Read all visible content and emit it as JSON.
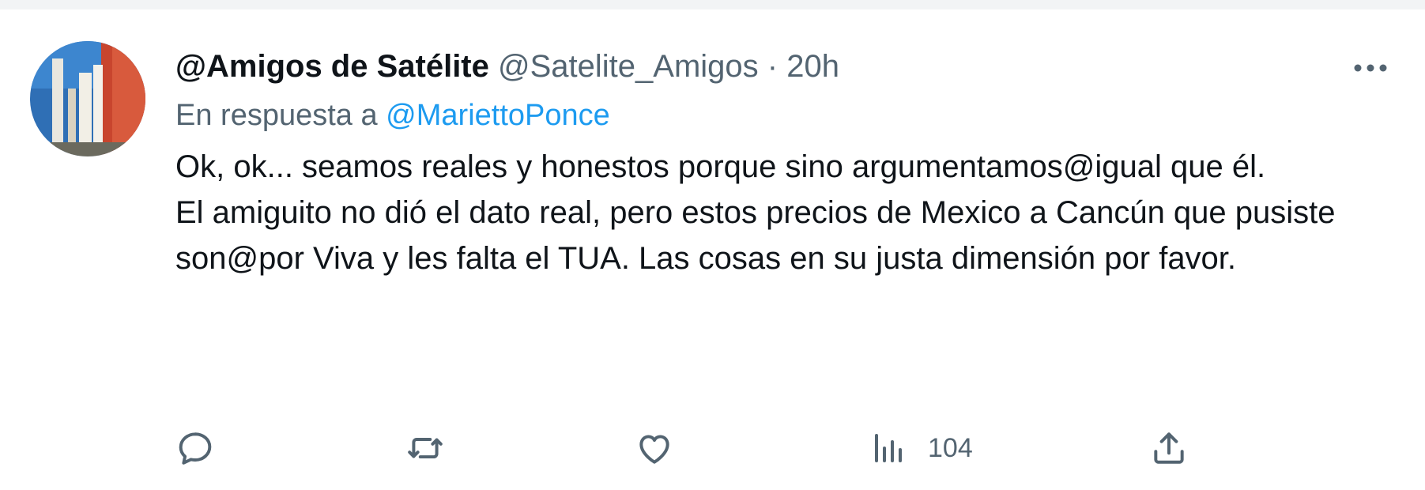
{
  "tweet": {
    "display_name": "@Amigos de Satélite",
    "handle": "@Satelite_Amigos",
    "separator": "·",
    "time": "20h",
    "reply_prefix": "En respuesta a",
    "reply_to": "@MariettoPonce",
    "body_lines": [
      "Ok, ok... seamos reales y honestos porque sino argumentamos@igual que él.",
      "El amiguito no dió el dato real, pero estos precios de Mexico a Cancún que pusiste son@por Viva y les falta el TUA. Las cosas en su justa dimensión por favor."
    ]
  },
  "actions": {
    "reply_icon": "reply-icon",
    "retweet_icon": "retweet-icon",
    "like_icon": "heart-icon",
    "views_icon": "views-chart-icon",
    "views_count": "104",
    "share_icon": "share-icon"
  },
  "colors": {
    "text_primary": "#0f1419",
    "text_secondary": "#536471",
    "link": "#1d9bf0"
  }
}
